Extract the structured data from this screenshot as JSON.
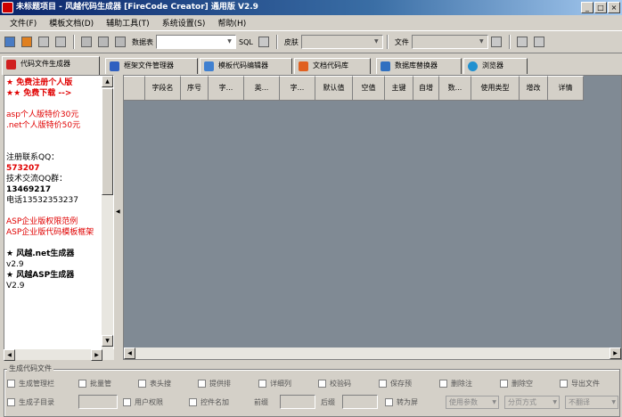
{
  "window": {
    "title": "未标题项目 - 风越代码生成器 [FireCode Creator] 通用版 V2.9"
  },
  "window_buttons": [
    "_",
    "□",
    "×"
  ],
  "menu": [
    "文件(F)",
    "模板文档(D)",
    "辅助工具(T)",
    "系统设置(S)",
    "帮助(H)"
  ],
  "toolbar": {
    "datatable_label": "数据表",
    "sql_label": "SQL",
    "skin_label": "皮肤",
    "file_label": "文件"
  },
  "tabs": [
    "代码文件生成器",
    "框架文件管理器",
    "模板代码编辑器",
    "文档代码库",
    "数据库替换器",
    "浏览器"
  ],
  "left_panel": {
    "promo1": "★ 免费注册个人版",
    "promo2": "★★ 免费下载 -->",
    "promo3": "asp个人版特价30元",
    "promo4": ".net个人版特价50元",
    "contact_label": "注册联系QQ：",
    "contact_qq": "573207",
    "group_label": "技术交流QQ群：",
    "group_qq": "13469217",
    "phone": "电话13532353237",
    "link1": "ASP企业版权限范例",
    "link2": "ASP企业版代码模板框架",
    "prod1": "★ 风越.net生成器",
    "prod1_ver": "v2.9",
    "prod2": "★ 风越ASP生成器",
    "prod2_ver": "V2.9"
  },
  "grid": {
    "columns": [
      "",
      "字段名",
      "序号",
      "字...",
      "英...",
      "字...",
      "默认值",
      "空值",
      "主键",
      "自增",
      "数...",
      "使用类型",
      "增改",
      "详情"
    ]
  },
  "bottom": {
    "group_title": "生成代码文件",
    "row1": [
      "生成管理栏",
      "批量管",
      "表头搜",
      "提供排",
      "详细列",
      "校验码",
      "保存预",
      "删除注",
      "删除空",
      "导出文件"
    ],
    "row2_check1": "生成子目录",
    "row2_check2": "用户权限",
    "row2_check3": "控件名加",
    "prefix_label": "前缀",
    "suffix_label": "后缀",
    "convert_label": "转为屏",
    "select1": "使用参数",
    "select2": "分页方式",
    "select3": "不翻译"
  }
}
